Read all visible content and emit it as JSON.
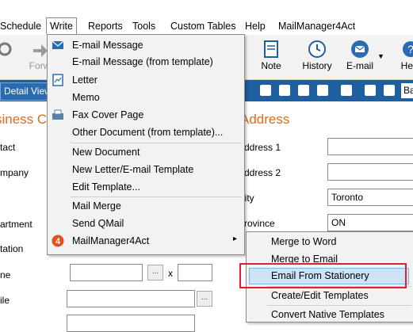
{
  "menubar": {
    "items": [
      "Schedule",
      "Write",
      "Reports",
      "Tools",
      "Custom Tables",
      "Help",
      "MailManager4Act"
    ]
  },
  "toolbar": {
    "forward_label": "Forw",
    "note_label": "Note",
    "history_label": "History",
    "email_label": "E-mail",
    "help_label": "Help",
    "search_value": "Ba"
  },
  "bluebar": {
    "detail_view_label": "Detail View"
  },
  "business_section": {
    "title": "siness C",
    "labels": [
      "tact",
      "mpany",
      "artment",
      "tation",
      "ne",
      "ile"
    ]
  },
  "address_section": {
    "title": "Address",
    "labels": [
      "Address 1",
      "Address 2",
      "City",
      "Province"
    ],
    "city_value": "Toronto",
    "province_value": "ON",
    "phone_ext_label": "x",
    "ellipsis": "..."
  },
  "write_menu": {
    "items": [
      "E-mail Message",
      "E-mail Message (from template)",
      "Letter",
      "Memo",
      "Fax Cover Page",
      "Other Document (from template)...",
      "New Document",
      "New Letter/E-mail Template",
      "Edit Template...",
      "Mail Merge",
      "Send QMail",
      "MailManager4Act"
    ],
    "submenu_arrow": "▸"
  },
  "submenu": {
    "items": [
      "Merge to Word",
      "Merge to Email",
      "Email From Stationery",
      "Create/Edit Templates",
      "Convert Native Templates"
    ]
  },
  "colors": {
    "accent_orange": "#e06b1a",
    "blue_bar": "#1f5fa0",
    "highlight": "#cce4f7",
    "annotation_red": "#e0202a"
  }
}
